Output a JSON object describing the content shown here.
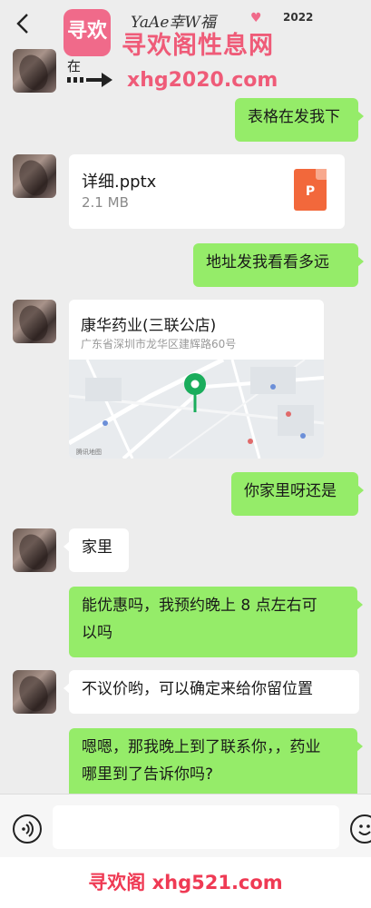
{
  "header": {
    "back_icon": "chevron-left-icon",
    "title_script": "YaAe幸W福",
    "title_year": "2022",
    "watermark_logo": "寻欢",
    "watermark_title": "寻欢阁性息网",
    "watermark_url": "xhg2020.com"
  },
  "messages": {
    "partial_text": "在",
    "m1": "表格在发我下",
    "file": {
      "name": "详细.pptx",
      "size": "2.1 MB",
      "icon_label": "P",
      "icon": "pptx-file-icon"
    },
    "m2": "地址发我看看多远",
    "location": {
      "name": "康华药业(三联公店)",
      "address": "广东省深圳市龙华区建辉路60号",
      "credit": "腾讯地图"
    },
    "m3": "你家里呀还是",
    "m4": "家里",
    "m5_line1": "能优惠吗，我预约晚上 8 点左右可",
    "m5_line2": "以吗",
    "m6": "不议价哟，可以确定来给你留位置",
    "m7_line1": "嗯嗯，那我晚上到了联系你，，药业",
    "m7_line2": "哪里到了告诉你吗?"
  },
  "input": {
    "voice_icon": "voice-icon",
    "emoji_icon": "emoji-icon",
    "value": ""
  },
  "footer": {
    "watermark": "寻欢阁 xhg521.com"
  },
  "colors": {
    "my_bubble": "#95ec69",
    "other_bubble": "#ffffff",
    "background": "#ededed",
    "watermark": "#ef5b78"
  }
}
